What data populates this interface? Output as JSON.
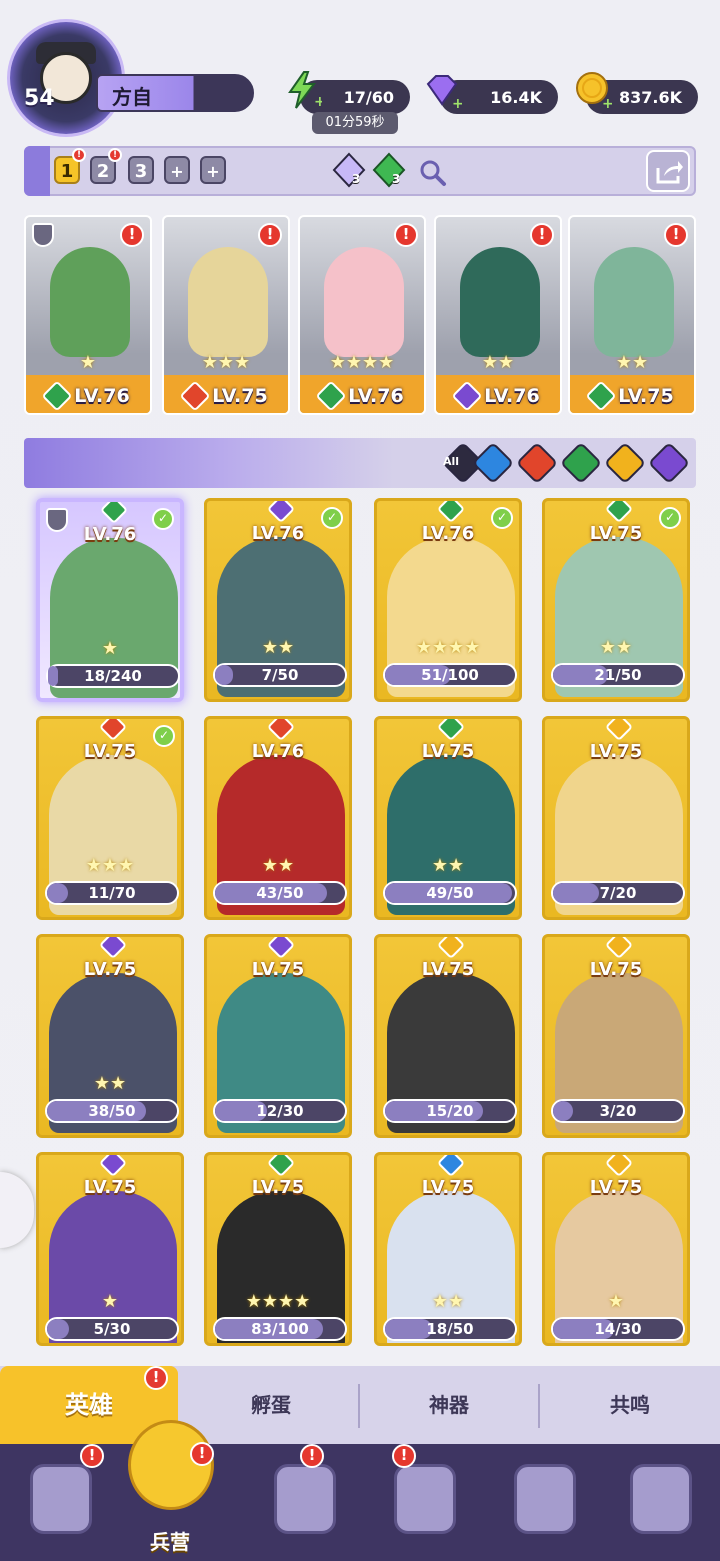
{
  "player": {
    "level": "54",
    "name": "方自"
  },
  "resources": {
    "energy": "17/60",
    "energy_timer": "01分59秒",
    "gems": "16.4K",
    "gold": "837.6K"
  },
  "team_slots": [
    "1",
    "2",
    "3",
    "+",
    "+"
  ],
  "gem_counts": [
    "3",
    "3"
  ],
  "deployed": [
    {
      "level": "LV.76",
      "stars": "★",
      "element": "#2fa24c",
      "alert": "!"
    },
    {
      "level": "LV.75",
      "stars": "★★★",
      "element": "#e1452b",
      "alert": "!"
    },
    {
      "level": "LV.76",
      "stars": "★★★★",
      "element": "#2fa24c",
      "alert": "!"
    },
    {
      "level": "LV.76",
      "stars": "★★",
      "element": "#7a4ad0",
      "alert": "!"
    },
    {
      "level": "LV.75",
      "stars": "★★",
      "element": "#2fa24c",
      "alert": "!"
    }
  ],
  "filter": {
    "all_label": "All",
    "colors": [
      "#2d86e0",
      "#e1452b",
      "#2fa24c",
      "#f1b21d",
      "#7a4ad0"
    ]
  },
  "heroes": [
    {
      "level": "LV.76",
      "shards": "18/240",
      "progress": 0.075,
      "stars": "★",
      "element": "#2fa24c",
      "checked": true,
      "selected": true
    },
    {
      "level": "LV.76",
      "shards": "7/50",
      "progress": 0.14,
      "stars": "★★",
      "element": "#7a4ad0",
      "checked": true
    },
    {
      "level": "LV.76",
      "shards": "51/100",
      "progress": 0.51,
      "stars": "★★★★",
      "element": "#2fa24c",
      "checked": true
    },
    {
      "level": "LV.75",
      "shards": "21/50",
      "progress": 0.42,
      "stars": "★★",
      "element": "#2fa24c",
      "checked": true
    },
    {
      "level": "LV.75",
      "shards": "11/70",
      "progress": 0.157,
      "stars": "★★★",
      "element": "#e1452b",
      "checked": true
    },
    {
      "level": "LV.76",
      "shards": "43/50",
      "progress": 0.86,
      "stars": "★★",
      "element": "#e1452b"
    },
    {
      "level": "LV.75",
      "shards": "49/50",
      "progress": 0.98,
      "stars": "★★",
      "element": "#2fa24c"
    },
    {
      "level": "LV.75",
      "shards": "7/20",
      "progress": 0.35,
      "stars": "",
      "element": "#f1b21d"
    },
    {
      "level": "LV.75",
      "shards": "38/50",
      "progress": 0.76,
      "stars": "★★",
      "element": "#7a4ad0"
    },
    {
      "level": "LV.75",
      "shards": "12/30",
      "progress": 0.4,
      "stars": "",
      "element": "#7a4ad0"
    },
    {
      "level": "LV.75",
      "shards": "15/20",
      "progress": 0.75,
      "stars": "",
      "element": "#f1b21d"
    },
    {
      "level": "LV.75",
      "shards": "3/20",
      "progress": 0.15,
      "stars": "",
      "element": "#f1b21d"
    },
    {
      "level": "LV.75",
      "shards": "5/30",
      "progress": 0.167,
      "stars": "★",
      "element": "#7a4ad0"
    },
    {
      "level": "LV.75",
      "shards": "83/100",
      "progress": 0.83,
      "stars": "★★★★",
      "element": "#2fa24c"
    },
    {
      "level": "LV.75",
      "shards": "18/50",
      "progress": 0.36,
      "stars": "★★",
      "element": "#2d86e0"
    },
    {
      "level": "LV.75",
      "shards": "14/30",
      "progress": 0.467,
      "stars": "★",
      "element": "#f1b21d"
    }
  ],
  "tabs": [
    "英雄",
    "孵蛋",
    "神器",
    "共鸣"
  ],
  "nav": {
    "barracks_label": "兵营"
  },
  "badge_alert": "!"
}
